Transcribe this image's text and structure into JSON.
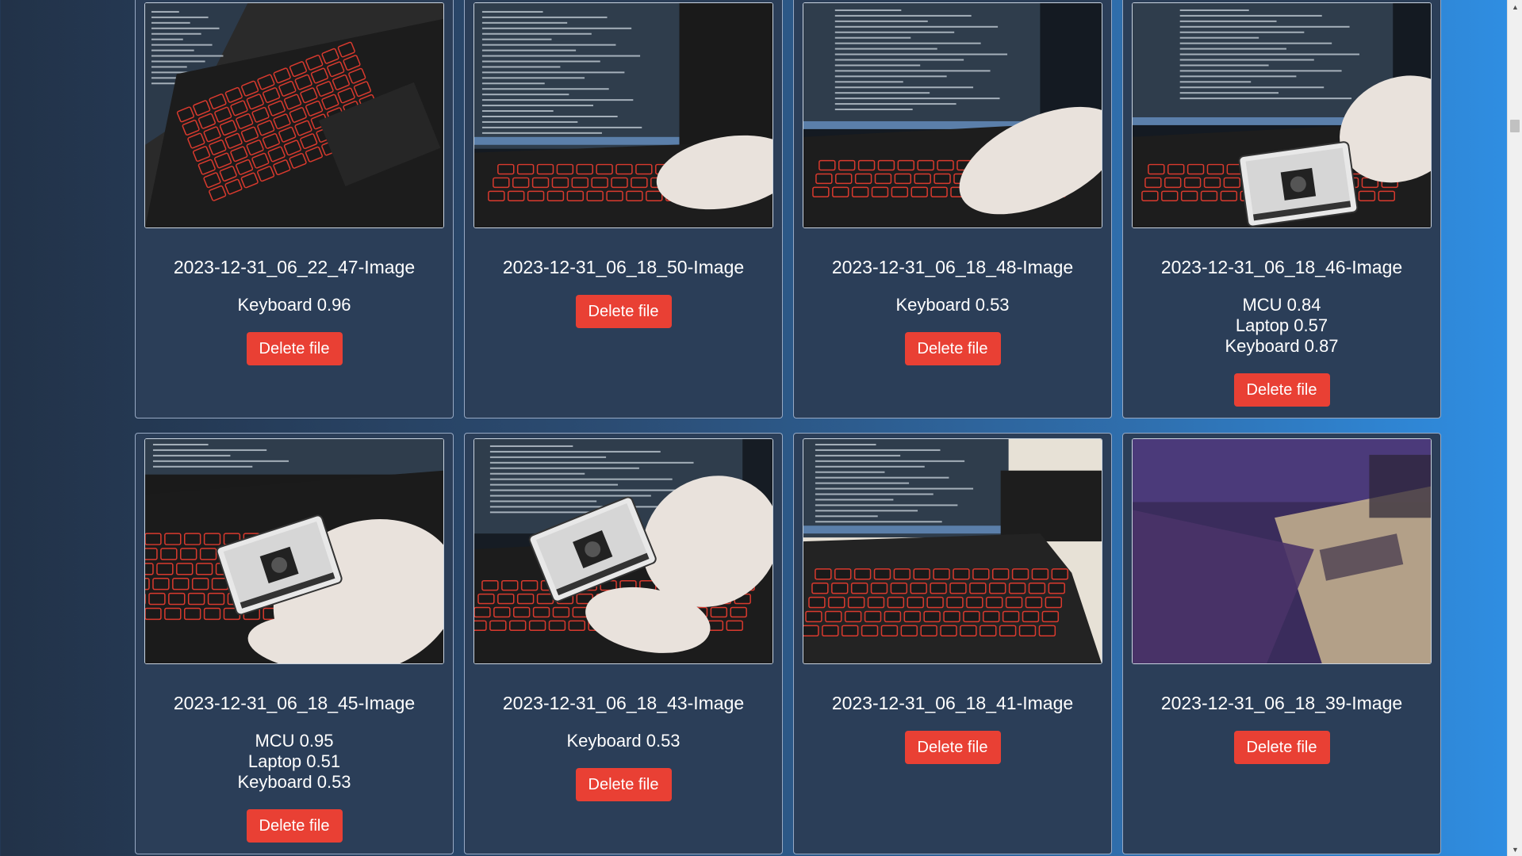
{
  "gallery": {
    "delete_label": "Delete file",
    "cards": [
      {
        "name": "2023-12-31_06_22_47-Image",
        "scene": "keyboard-closeup",
        "detections": [
          "Keyboard 0.96"
        ]
      },
      {
        "name": "2023-12-31_06_18_50-Image",
        "scene": "laptop-hand",
        "detections": []
      },
      {
        "name": "2023-12-31_06_18_48-Image",
        "scene": "laptop-hand-board",
        "detections": [
          "Keyboard 0.53"
        ]
      },
      {
        "name": "2023-12-31_06_18_46-Image",
        "scene": "laptop-board",
        "detections": [
          "MCU 0.84",
          "Laptop 0.57",
          "Keyboard 0.87"
        ]
      },
      {
        "name": "2023-12-31_06_18_45-Image",
        "scene": "board-closeup",
        "detections": [
          "MCU 0.95",
          "Laptop 0.51",
          "Keyboard 0.53"
        ]
      },
      {
        "name": "2023-12-31_06_18_43-Image",
        "scene": "board-over-keyboard",
        "detections": [
          "Keyboard 0.53"
        ]
      },
      {
        "name": "2023-12-31_06_18_41-Image",
        "scene": "laptop-keyboard",
        "detections": []
      },
      {
        "name": "2023-12-31_06_18_39-Image",
        "scene": "blurry-purple",
        "detections": []
      }
    ]
  }
}
